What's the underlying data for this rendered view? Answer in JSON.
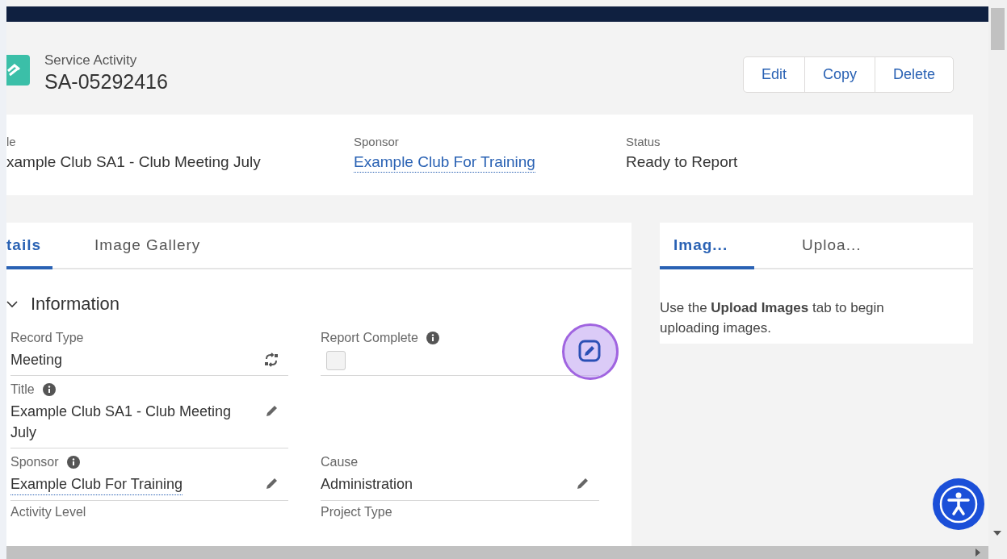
{
  "record": {
    "object_type": "Service Activity",
    "name": "SA-05292416"
  },
  "actions": [
    "Edit",
    "Copy",
    "Delete"
  ],
  "highlights": [
    {
      "label": "le",
      "value": "xample Club SA1 - Club Meeting July",
      "kind": "text"
    },
    {
      "label": "Sponsor",
      "value": "Example Club For Training",
      "kind": "link"
    },
    {
      "label": "Status",
      "value": "Ready to Report",
      "kind": "text"
    }
  ],
  "tabs": [
    {
      "label": "tails",
      "selected": true
    },
    {
      "label": "Image Gallery",
      "selected": false
    }
  ],
  "section": {
    "title": "Information",
    "expanded": true
  },
  "rows": [
    {
      "fields": [
        {
          "label": "Record Type",
          "value": "Meeting",
          "kind": "text",
          "info": false,
          "action": {
            "kind": "switch"
          }
        },
        {
          "label": "Report Complete",
          "kind": "checkbox",
          "checked": false,
          "info": true,
          "action": {
            "kind": "edit"
          },
          "highlighted": true
        }
      ]
    },
    {
      "fields": [
        {
          "label": "Title",
          "value": "Example Club SA1 - Club Meeting July",
          "kind": "text",
          "info": true,
          "action": {
            "kind": "pencil"
          }
        }
      ]
    },
    {
      "fields": [
        {
          "label": "Sponsor",
          "value": "Example Club For Training",
          "kind": "link",
          "info": true,
          "action": {
            "kind": "pencil"
          }
        },
        {
          "label": "Cause",
          "value": "Administration",
          "kind": "text",
          "info": false,
          "action": {
            "kind": "pencil"
          }
        }
      ]
    },
    {
      "fields": [
        {
          "label": "Activity Level",
          "kind": "label",
          "info": false
        },
        {
          "label": "Project Type",
          "kind": "label",
          "info": false
        }
      ]
    }
  ],
  "side_tabs": [
    {
      "label": "Imag...",
      "selected": true
    },
    {
      "label": "Uploa...",
      "selected": false
    }
  ],
  "side_message": "Use the **Upload Images** tab to begin uploading images."
}
